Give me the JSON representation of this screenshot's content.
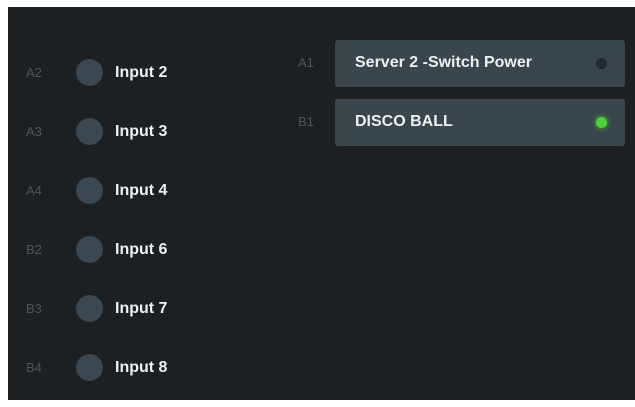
{
  "inputs": [
    {
      "port": "A2",
      "label": "Input 2"
    },
    {
      "port": "A3",
      "label": "Input 3"
    },
    {
      "port": "A4",
      "label": "Input 4"
    },
    {
      "port": "B2",
      "label": "Input 6"
    },
    {
      "port": "B3",
      "label": "Input 7"
    },
    {
      "port": "B4",
      "label": "Input 8"
    }
  ],
  "outputs": [
    {
      "port": "A1",
      "label": "Server 2 -Switch Power",
      "state": "off",
      "led_color": "#22292d"
    },
    {
      "port": "B1",
      "label": "DISCO BALL",
      "state": "on",
      "led_color": "#4cd137"
    }
  ],
  "colors": {
    "panel_background": "#1c2023",
    "button_background": "#3a454c",
    "led_on": "#4cd137",
    "led_off": "#22292d",
    "input_dot": "#3d474f"
  },
  "icons": {
    "input_indicator": "circle-icon",
    "output_indicator": "status-led-icon"
  }
}
